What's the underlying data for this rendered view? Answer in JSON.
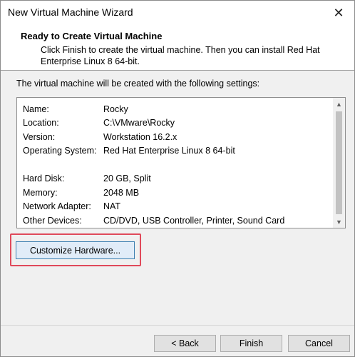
{
  "window": {
    "title": "New Virtual Machine Wizard",
    "close_glyph": "✕"
  },
  "header": {
    "title": "Ready to Create Virtual Machine",
    "description": "Click Finish to create the virtual machine. Then you can install Red Hat Enterprise Linux 8 64-bit."
  },
  "intro": "The virtual machine will be created with the following settings:",
  "settings": {
    "rows": [
      {
        "label": "Name:",
        "value": "Rocky"
      },
      {
        "label": "Location:",
        "value": "C:\\VMware\\Rocky"
      },
      {
        "label": "Version:",
        "value": "Workstation 16.2.x"
      },
      {
        "label": "Operating System:",
        "value": "Red Hat Enterprise Linux 8 64-bit"
      },
      {
        "label": "",
        "value": ""
      },
      {
        "label": "Hard Disk:",
        "value": "20 GB, Split"
      },
      {
        "label": "Memory:",
        "value": "2048 MB"
      },
      {
        "label": "Network Adapter:",
        "value": "NAT"
      },
      {
        "label": "Other Devices:",
        "value": "CD/DVD, USB Controller, Printer, Sound Card"
      }
    ],
    "scroll_up_glyph": "▲",
    "scroll_down_glyph": "▼"
  },
  "buttons": {
    "customize": "Customize Hardware...",
    "back": "< Back",
    "finish": "Finish",
    "cancel": "Cancel"
  },
  "colors": {
    "highlight": "#e0495a",
    "primary_button_border": "#3c7fb1",
    "primary_button_bg": "#e1ecf8"
  }
}
